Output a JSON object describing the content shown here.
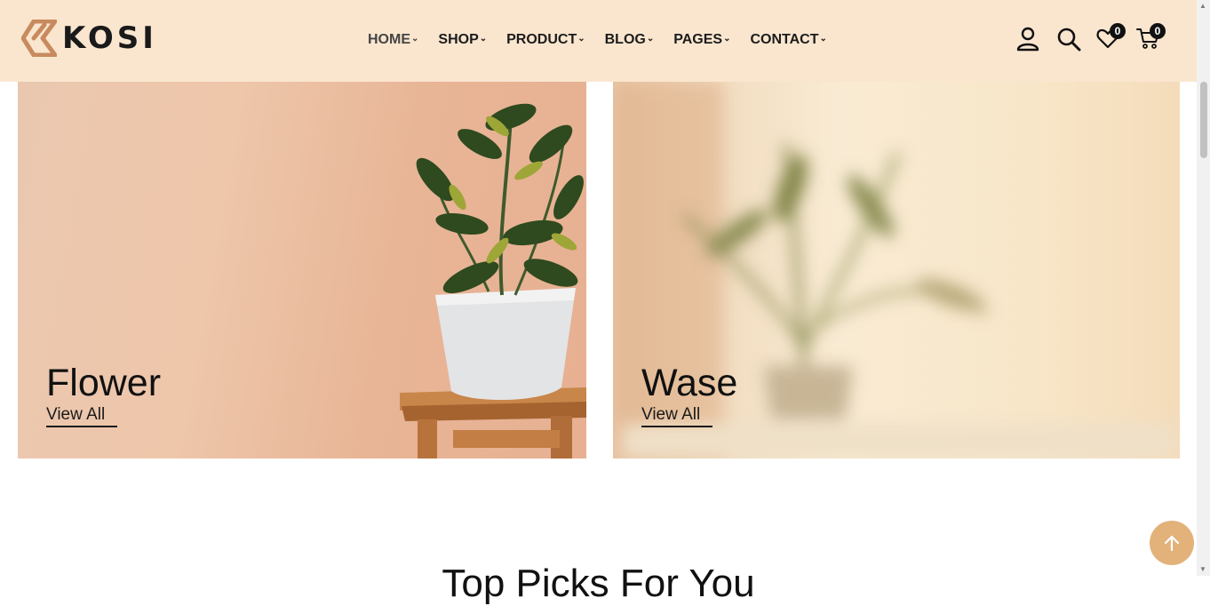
{
  "brand": {
    "name": "KOSI"
  },
  "nav": {
    "items": [
      {
        "label": "HOME",
        "active": true
      },
      {
        "label": "SHOP",
        "active": false
      },
      {
        "label": "PRODUCT",
        "active": false
      },
      {
        "label": "BLOG",
        "active": false
      },
      {
        "label": "PAGES",
        "active": false
      },
      {
        "label": "CONTACT",
        "active": false
      }
    ]
  },
  "header_icons": {
    "account": "user-icon",
    "search": "search-icon",
    "wishlist": {
      "icon": "heart-icon",
      "count": "0"
    },
    "cart": {
      "icon": "cart-icon",
      "count": "0"
    }
  },
  "categories": [
    {
      "title": "Flower",
      "link": "View All"
    },
    {
      "title": "Wase",
      "link": "View All"
    }
  ],
  "section": {
    "title": "Top Picks For You"
  },
  "colors": {
    "header_bg": "#fae6cf",
    "accent": "#e2b27a",
    "logo_accent": "#c88a5e"
  }
}
